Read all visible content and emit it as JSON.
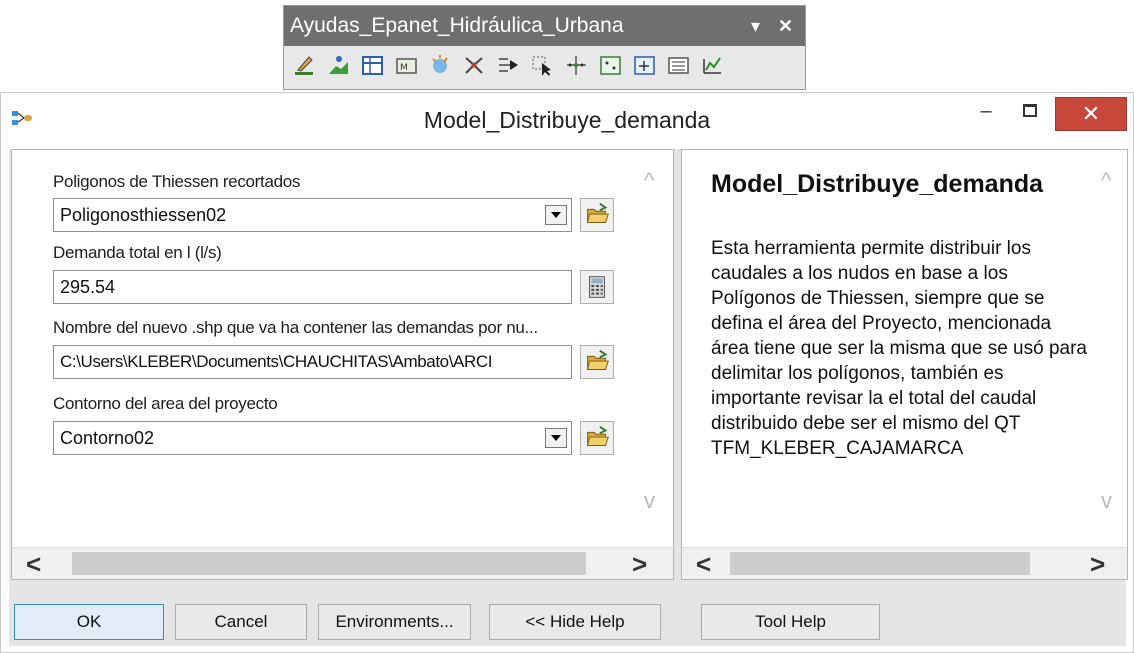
{
  "toolbar": {
    "title": "Ayudas_Epanet_Hidráulica_Urbana",
    "dropdown_glyph": "▾",
    "close_glyph": "✕",
    "icons": [
      "edit-icon",
      "profile-icon",
      "table-icon",
      "map-icon",
      "sparkle-icon",
      "nodes-icon",
      "arrow-flow-icon",
      "select-arrow-icon",
      "move-points-icon",
      "grid-points-icon",
      "grid-cross-icon",
      "list-icon",
      "chart-tool-icon"
    ]
  },
  "dialog": {
    "title": "Model_Distribuye_demanda",
    "minimize_glyph": "–",
    "close_glyph": "✕",
    "params": {
      "p1_label": "Poligonos de Thiessen recortados",
      "p1_value": "Poligonosthiessen02",
      "p2_label": "Demanda total en l (l/s)",
      "p2_value": "295.54",
      "p3_label": "Nombre del nuevo .shp que va ha contener las demandas por nu...",
      "p3_value": "C:\\Users\\KLEBER\\Documents\\CHAUCHITAS\\Ambato\\ARCI",
      "p4_label": "Contorno del area del proyecto",
      "p4_value": "Contorno02"
    },
    "help": {
      "title": "Model_Distribuye_demanda",
      "body": "Esta herramienta permite distribuir los caudales a los nudos en base a los Polígonos de Thiessen, siempre que se defina el área del Proyecto, mencionada área tiene que ser la misma que se usó para delimitar los polígonos, también es importante revisar la el total del caudal distribuido debe ser el mismo del QT TFM_KLEBER_CAJAMARCA"
    },
    "buttons": {
      "ok": "OK",
      "cancel": "Cancel",
      "environments": "Environments...",
      "hide_help": "<< Hide Help",
      "tool_help": "Tool Help"
    },
    "glyphs": {
      "up": "^",
      "down": "v",
      "left": "<",
      "right": ">"
    }
  }
}
